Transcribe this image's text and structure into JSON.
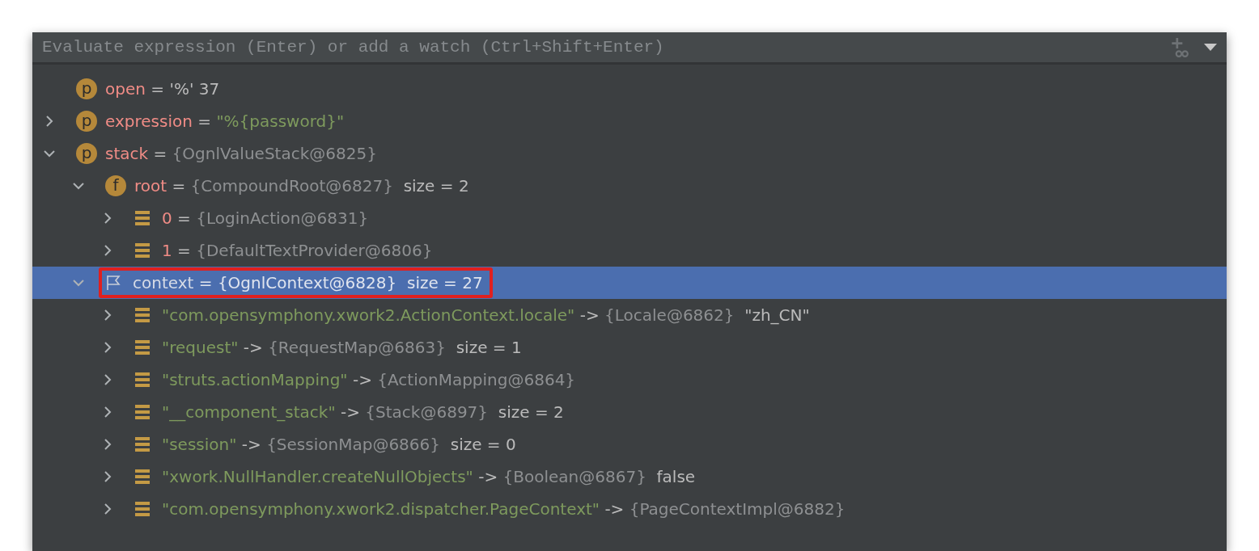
{
  "watch_field": {
    "placeholder": "Evaluate expression (Enter) or add a watch (Ctrl+Shift+Enter)"
  },
  "tree": [
    {
      "kind": "param",
      "badge": "p",
      "name": "open",
      "sep": "=",
      "value": "'%' 37",
      "selected": false,
      "annotated": false
    },
    {
      "kind": "param",
      "badge": "p",
      "name": "expression",
      "sep": "=",
      "string": "\"%{password}\"",
      "expanded": false,
      "selected": false,
      "annotated": false
    },
    {
      "kind": "param",
      "badge": "p",
      "name": "stack",
      "sep": "=",
      "ref": "{OgnlValueStack@6825}",
      "expanded": true,
      "selected": false,
      "annotated": false,
      "children": [
        {
          "kind": "field",
          "badge": "f",
          "name": "root",
          "sep": "=",
          "ref": "{CompoundRoot@6827}",
          "extra": "size = 2",
          "expanded": true,
          "selected": false,
          "annotated": false,
          "children": [
            {
              "kind": "index",
              "name": "0",
              "sep": "=",
              "ref": "{LoginAction@6831}",
              "expanded": false,
              "selected": false,
              "annotated": false
            },
            {
              "kind": "index",
              "name": "1",
              "sep": "=",
              "ref": "{DefaultTextProvider@6806}",
              "expanded": false,
              "selected": false,
              "annotated": false
            }
          ]
        },
        {
          "kind": "flag",
          "name": "context",
          "sep": "=",
          "ref": "{OgnlContext@6828}",
          "extra": "size = 27",
          "expanded": true,
          "selected": true,
          "annotated": true,
          "children": [
            {
              "kind": "entry",
              "name": "\"com.opensymphony.xwork2.ActionContext.locale\"",
              "sep": "->",
              "ref": "{Locale@6862}",
              "extra": "\"zh_CN\"",
              "expanded": false,
              "selected": false,
              "annotated": false
            },
            {
              "kind": "entry",
              "name": "\"request\"",
              "sep": "->",
              "ref": "{RequestMap@6863}",
              "extra": "size = 1",
              "expanded": false,
              "selected": false,
              "annotated": false
            },
            {
              "kind": "entry",
              "name": "\"struts.actionMapping\"",
              "sep": "->",
              "ref": "{ActionMapping@6864}",
              "expanded": false,
              "selected": false,
              "annotated": false
            },
            {
              "kind": "entry",
              "name": "\"__component_stack\"",
              "sep": "->",
              "ref": "{Stack@6897}",
              "extra": "size = 2",
              "expanded": false,
              "selected": false,
              "annotated": false
            },
            {
              "kind": "entry",
              "name": "\"session\"",
              "sep": "->",
              "ref": "{SessionMap@6866}",
              "extra": "size = 0",
              "expanded": false,
              "selected": false,
              "annotated": false
            },
            {
              "kind": "entry",
              "name": "\"xwork.NullHandler.createNullObjects\"",
              "sep": "->",
              "ref": "{Boolean@6867}",
              "extra": "false",
              "expanded": false,
              "selected": false,
              "annotated": false
            },
            {
              "kind": "entry",
              "name": "\"com.opensymphony.xwork2.dispatcher.PageContext\"",
              "sep": "->",
              "ref": "{PageContextImpl@6882}",
              "expanded": false,
              "selected": false,
              "annotated": false
            }
          ]
        }
      ]
    }
  ]
}
